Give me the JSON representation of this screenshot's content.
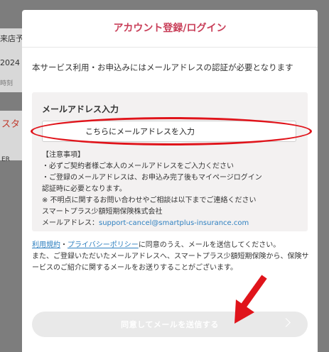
{
  "background": {
    "items": [
      "来店予",
      "2024",
      "時刻",
      "スタ",
      "ER"
    ]
  },
  "modal": {
    "title": "アカウント登録/ログイン",
    "intro": "本サービス利用・お申込みにはメールアドレスの認証が必要となります"
  },
  "email_panel": {
    "label": "メールアドレス入力",
    "placeholder": "こちらにメールアドレスを入力",
    "notes": [
      "【注意事項】",
      "・必ずご契約者様ご本人のメールアドレスをご入力ください",
      "・ご登録のメールアドレスは、お申込み完了後もマイページログイン",
      "認証時に必要となります。",
      "※ 不明点に関するお問い合わせやご相談は以下までご連絡ください",
      "スマートプラス少額短期保険株式会社"
    ],
    "contact_prefix": "メールアドレス：",
    "contact_email": "support-cancel@smartplus-insurance.com"
  },
  "consent": {
    "terms_link": "利用規約",
    "separator": "・",
    "privacy_link": "プライバシーポリシー",
    "text1": "に同意のうえ、メールを送信してください。",
    "text2": "また、ご登録いただいたメールアドレスへ、スマートプラス少額短期保険から、保険サービスのご紹介に関するメールをお送りすることがございます。"
  },
  "submit": {
    "label": "同意してメールを送信する",
    "icon": "chevron-right-icon"
  },
  "colors": {
    "accent": "#c9405a",
    "link": "#2f80c0",
    "annotation": "#e0141b"
  }
}
